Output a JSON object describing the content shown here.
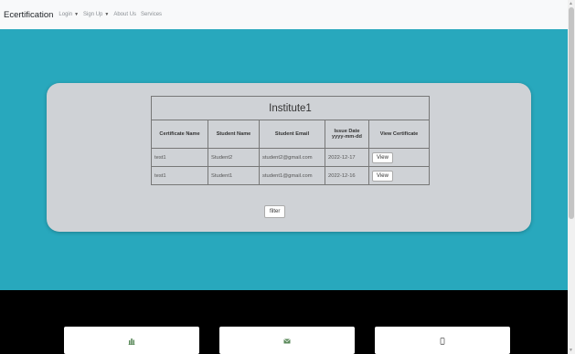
{
  "navbar": {
    "brand": "Ecertification",
    "items": [
      {
        "label": "Login",
        "dropdown": true
      },
      {
        "label": "Sign Up",
        "dropdown": true
      },
      {
        "label": "About Us",
        "dropdown": false
      },
      {
        "label": "Services",
        "dropdown": false
      }
    ]
  },
  "table": {
    "institute": "Institute1",
    "headers": {
      "certificate_name": "Certificate Name",
      "student_name": "Student Name",
      "student_email": "Student Email",
      "issue_date": "Issue Date",
      "issue_date_format": "yyyy-mm-dd",
      "view_certificate": "View Certificate"
    },
    "rows": [
      {
        "certificate_name": "test1",
        "student_name": "Student2",
        "student_email": "student2@gmail.com",
        "issue_date": "2022-12-17",
        "view_label": "View"
      },
      {
        "certificate_name": "test1",
        "student_name": "Student1",
        "student_email": "student1@gmail.com",
        "issue_date": "2022-12-16",
        "view_label": "View"
      }
    ]
  },
  "filter_label": "filter",
  "footer_cards": [
    {
      "icon": "building-icon"
    },
    {
      "icon": "envelope-icon"
    },
    {
      "icon": "mobile-icon"
    }
  ],
  "colors": {
    "hero": "#28a8bd",
    "card": "#cfd2d6",
    "footer": "#000000"
  }
}
